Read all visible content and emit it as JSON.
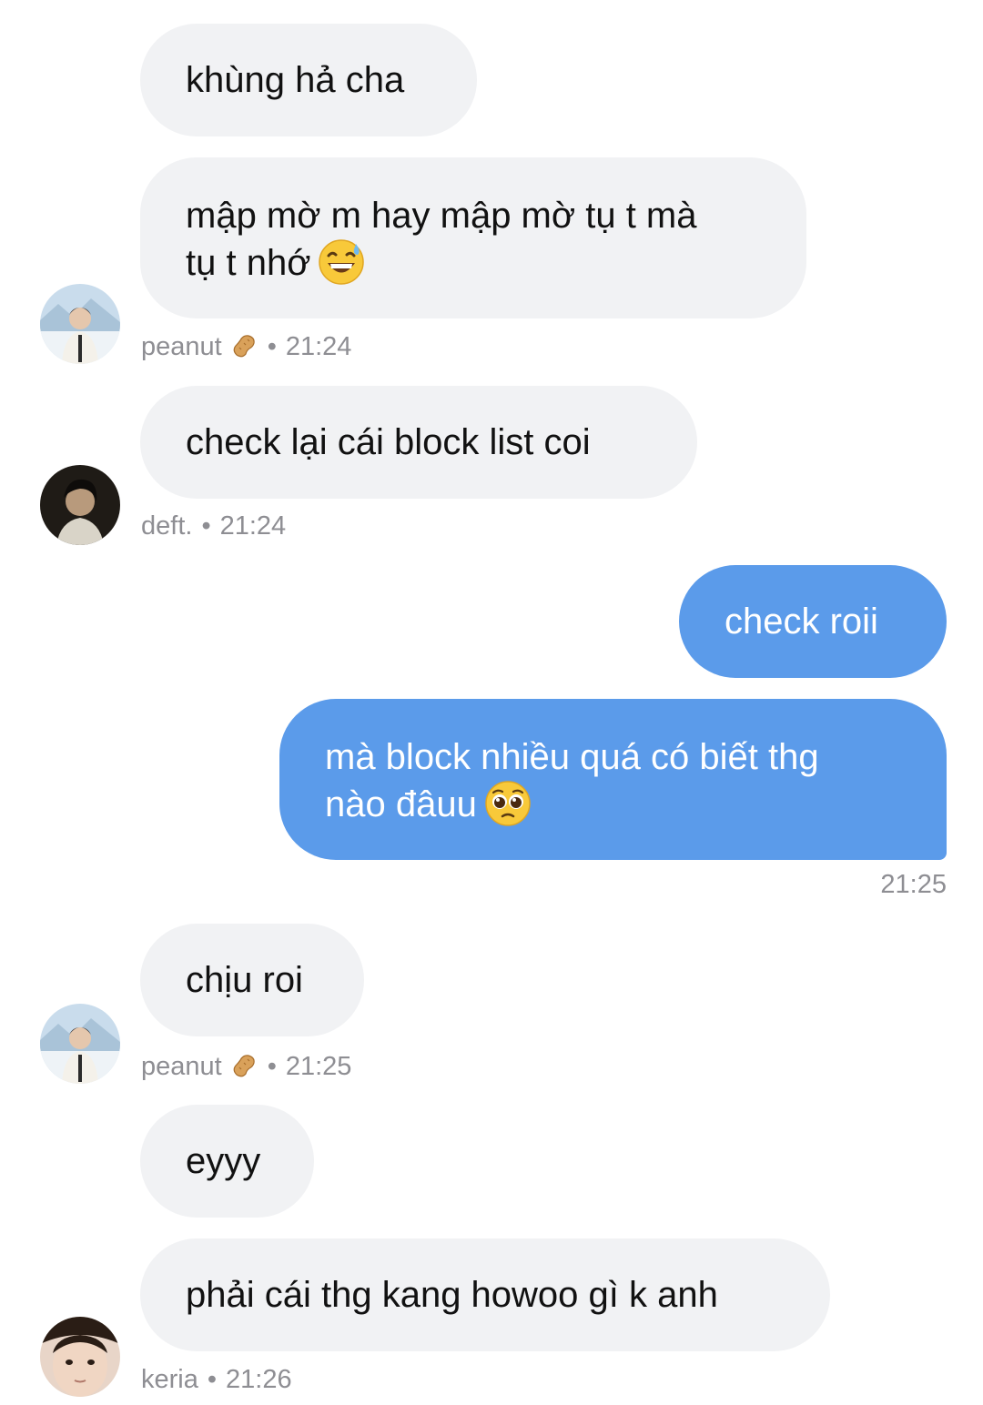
{
  "messages": [
    {
      "text": "khùng hả cha"
    },
    {
      "line1": "mập mờ m hay mập mờ tụ t mà",
      "line2": "tụ t nhớ",
      "emoji": "grinning-sweat-emoji",
      "sender": "peanut",
      "time": "21:24"
    },
    {
      "text": "check lại cái block list coi",
      "sender": "deft.",
      "time": "21:24"
    },
    {
      "text": "check roii"
    },
    {
      "line1": "mà block nhiều quá có biết thg",
      "line2": "nào đâuu",
      "emoji": "pleading-face-emoji",
      "time": "21:25"
    },
    {
      "text": "chịu roi",
      "sender": "peanut",
      "time": "21:25"
    },
    {
      "text": "eyyy"
    },
    {
      "text": "phải cái thg kang howoo gì k anh",
      "sender": "keria",
      "time": "21:26"
    }
  ],
  "separator": "•",
  "icons": {
    "peanut": "peanut-icon"
  },
  "colors": {
    "incoming_bubble": "#f1f2f4",
    "outgoing_bubble": "#5b9bea",
    "meta_text": "#8e8e93"
  }
}
